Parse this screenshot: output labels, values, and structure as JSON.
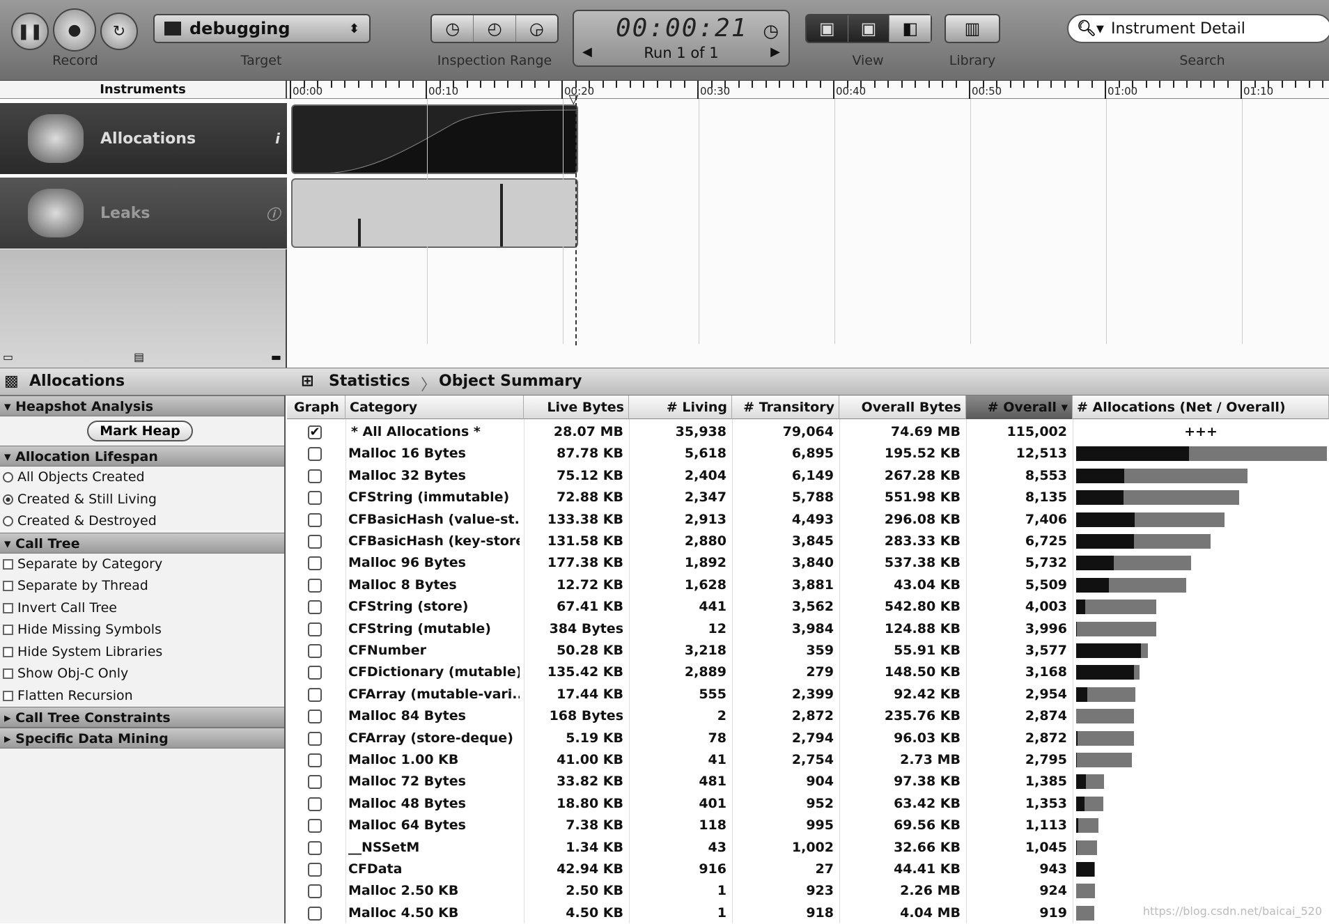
{
  "toolbar": {
    "record_label": "Record",
    "target_label": "Target",
    "target_value": "debugging",
    "inspection_label": "Inspection Range",
    "clock_time": "00:00:21",
    "run_label": "Run 1 of 1",
    "view_label": "View",
    "library_label": "Library",
    "search_label": "Search",
    "search_value": "Instrument Detail"
  },
  "timeline": {
    "header": "Instruments",
    "ticks": [
      "00:00",
      "00:10",
      "00:20",
      "00:30",
      "00:40",
      "00:50",
      "01:00",
      "01:10"
    ],
    "playhead_seconds": 21,
    "instruments": [
      {
        "name": "Allocations",
        "icon": "allocations-icon"
      },
      {
        "name": "Leaks",
        "icon": "leaks-icon"
      }
    ]
  },
  "detail": {
    "instrument": "Allocations",
    "breadcrumbs": [
      "Statistics",
      "Object Summary"
    ]
  },
  "sidebar": {
    "heapshot": "Heapshot Analysis",
    "mark_heap": "Mark Heap",
    "lifespan": "Allocation Lifespan",
    "lifespan_options": [
      {
        "label": "All Objects Created",
        "selected": false
      },
      {
        "label": "Created & Still Living",
        "selected": true
      },
      {
        "label": "Created & Destroyed",
        "selected": false
      }
    ],
    "call_tree": "Call Tree",
    "call_tree_options": [
      "Separate by Category",
      "Separate by Thread",
      "Invert Call Tree",
      "Hide Missing Symbols",
      "Hide System Libraries",
      "Show Obj-C Only",
      "Flatten Recursion"
    ],
    "constraints": "Call Tree Constraints",
    "data_mining": "Specific Data Mining"
  },
  "table": {
    "columns": [
      "Graph",
      "Category",
      "Live Bytes",
      "# Living",
      "# Transitory",
      "Overall Bytes",
      "# Overall ▾",
      "# Allocations (Net / Overall)"
    ],
    "summary_marker": "+++",
    "rows": [
      {
        "graph": true,
        "category": "* All Allocations *",
        "live_bytes": "28.07 MB",
        "living": "35,938",
        "transitory": "79,064",
        "overall_bytes": "74.69 MB",
        "overall": "115,002"
      },
      {
        "graph": false,
        "category": "Malloc 16 Bytes",
        "live_bytes": "87.78 KB",
        "living": "5,618",
        "transitory": "6,895",
        "overall_bytes": "195.52 KB",
        "overall": "12,513"
      },
      {
        "graph": false,
        "category": "Malloc 32 Bytes",
        "live_bytes": "75.12 KB",
        "living": "2,404",
        "transitory": "6,149",
        "overall_bytes": "267.28 KB",
        "overall": "8,553"
      },
      {
        "graph": false,
        "category": "CFString (immutable)",
        "live_bytes": "72.88 KB",
        "living": "2,347",
        "transitory": "5,788",
        "overall_bytes": "551.98 KB",
        "overall": "8,135"
      },
      {
        "graph": false,
        "category": "CFBasicHash (value-st...",
        "live_bytes": "133.38 KB",
        "living": "2,913",
        "transitory": "4,493",
        "overall_bytes": "296.08 KB",
        "overall": "7,406"
      },
      {
        "graph": false,
        "category": "CFBasicHash (key-store)",
        "live_bytes": "131.58 KB",
        "living": "2,880",
        "transitory": "3,845",
        "overall_bytes": "283.33 KB",
        "overall": "6,725"
      },
      {
        "graph": false,
        "category": "Malloc 96 Bytes",
        "live_bytes": "177.38 KB",
        "living": "1,892",
        "transitory": "3,840",
        "overall_bytes": "537.38 KB",
        "overall": "5,732"
      },
      {
        "graph": false,
        "category": "Malloc 8 Bytes",
        "live_bytes": "12.72 KB",
        "living": "1,628",
        "transitory": "3,881",
        "overall_bytes": "43.04 KB",
        "overall": "5,509"
      },
      {
        "graph": false,
        "category": "CFString (store)",
        "live_bytes": "67.41 KB",
        "living": "441",
        "transitory": "3,562",
        "overall_bytes": "542.80 KB",
        "overall": "4,003"
      },
      {
        "graph": false,
        "category": "CFString (mutable)",
        "live_bytes": "384 Bytes",
        "living": "12",
        "transitory": "3,984",
        "overall_bytes": "124.88 KB",
        "overall": "3,996"
      },
      {
        "graph": false,
        "category": "CFNumber",
        "live_bytes": "50.28 KB",
        "living": "3,218",
        "transitory": "359",
        "overall_bytes": "55.91 KB",
        "overall": "3,577"
      },
      {
        "graph": false,
        "category": "CFDictionary (mutable)",
        "live_bytes": "135.42 KB",
        "living": "2,889",
        "transitory": "279",
        "overall_bytes": "148.50 KB",
        "overall": "3,168"
      },
      {
        "graph": false,
        "category": "CFArray (mutable-vari...",
        "live_bytes": "17.44 KB",
        "living": "555",
        "transitory": "2,399",
        "overall_bytes": "92.42 KB",
        "overall": "2,954"
      },
      {
        "graph": false,
        "category": "Malloc 84 Bytes",
        "live_bytes": "168 Bytes",
        "living": "2",
        "transitory": "2,872",
        "overall_bytes": "235.76 KB",
        "overall": "2,874"
      },
      {
        "graph": false,
        "category": "CFArray (store-deque)",
        "live_bytes": "5.19 KB",
        "living": "78",
        "transitory": "2,794",
        "overall_bytes": "96.03 KB",
        "overall": "2,872"
      },
      {
        "graph": false,
        "category": "Malloc 1.00 KB",
        "live_bytes": "41.00 KB",
        "living": "41",
        "transitory": "2,754",
        "overall_bytes": "2.73 MB",
        "overall": "2,795"
      },
      {
        "graph": false,
        "category": "Malloc 72 Bytes",
        "live_bytes": "33.82 KB",
        "living": "481",
        "transitory": "904",
        "overall_bytes": "97.38 KB",
        "overall": "1,385"
      },
      {
        "graph": false,
        "category": "Malloc 48 Bytes",
        "live_bytes": "18.80 KB",
        "living": "401",
        "transitory": "952",
        "overall_bytes": "63.42 KB",
        "overall": "1,353"
      },
      {
        "graph": false,
        "category": "Malloc 64 Bytes",
        "live_bytes": "7.38 KB",
        "living": "118",
        "transitory": "995",
        "overall_bytes": "69.56 KB",
        "overall": "1,113"
      },
      {
        "graph": false,
        "category": "__NSSetM",
        "live_bytes": "1.34 KB",
        "living": "43",
        "transitory": "1,002",
        "overall_bytes": "32.66 KB",
        "overall": "1,045"
      },
      {
        "graph": false,
        "category": "CFData",
        "live_bytes": "42.94 KB",
        "living": "916",
        "transitory": "27",
        "overall_bytes": "44.41 KB",
        "overall": "943"
      },
      {
        "graph": false,
        "category": "Malloc 2.50 KB",
        "live_bytes": "2.50 KB",
        "living": "1",
        "transitory": "923",
        "overall_bytes": "2.26 MB",
        "overall": "924"
      },
      {
        "graph": false,
        "category": "Malloc 4.50 KB",
        "live_bytes": "4.50 KB",
        "living": "1",
        "transitory": "918",
        "overall_bytes": "4.04 MB",
        "overall": "919"
      }
    ]
  },
  "colors": {
    "net_bar": "#111111",
    "overall_bar": "#777777",
    "sorted_header": "#6a6a6a"
  },
  "watermark": "https://blog.csdn.net/baicai_520"
}
